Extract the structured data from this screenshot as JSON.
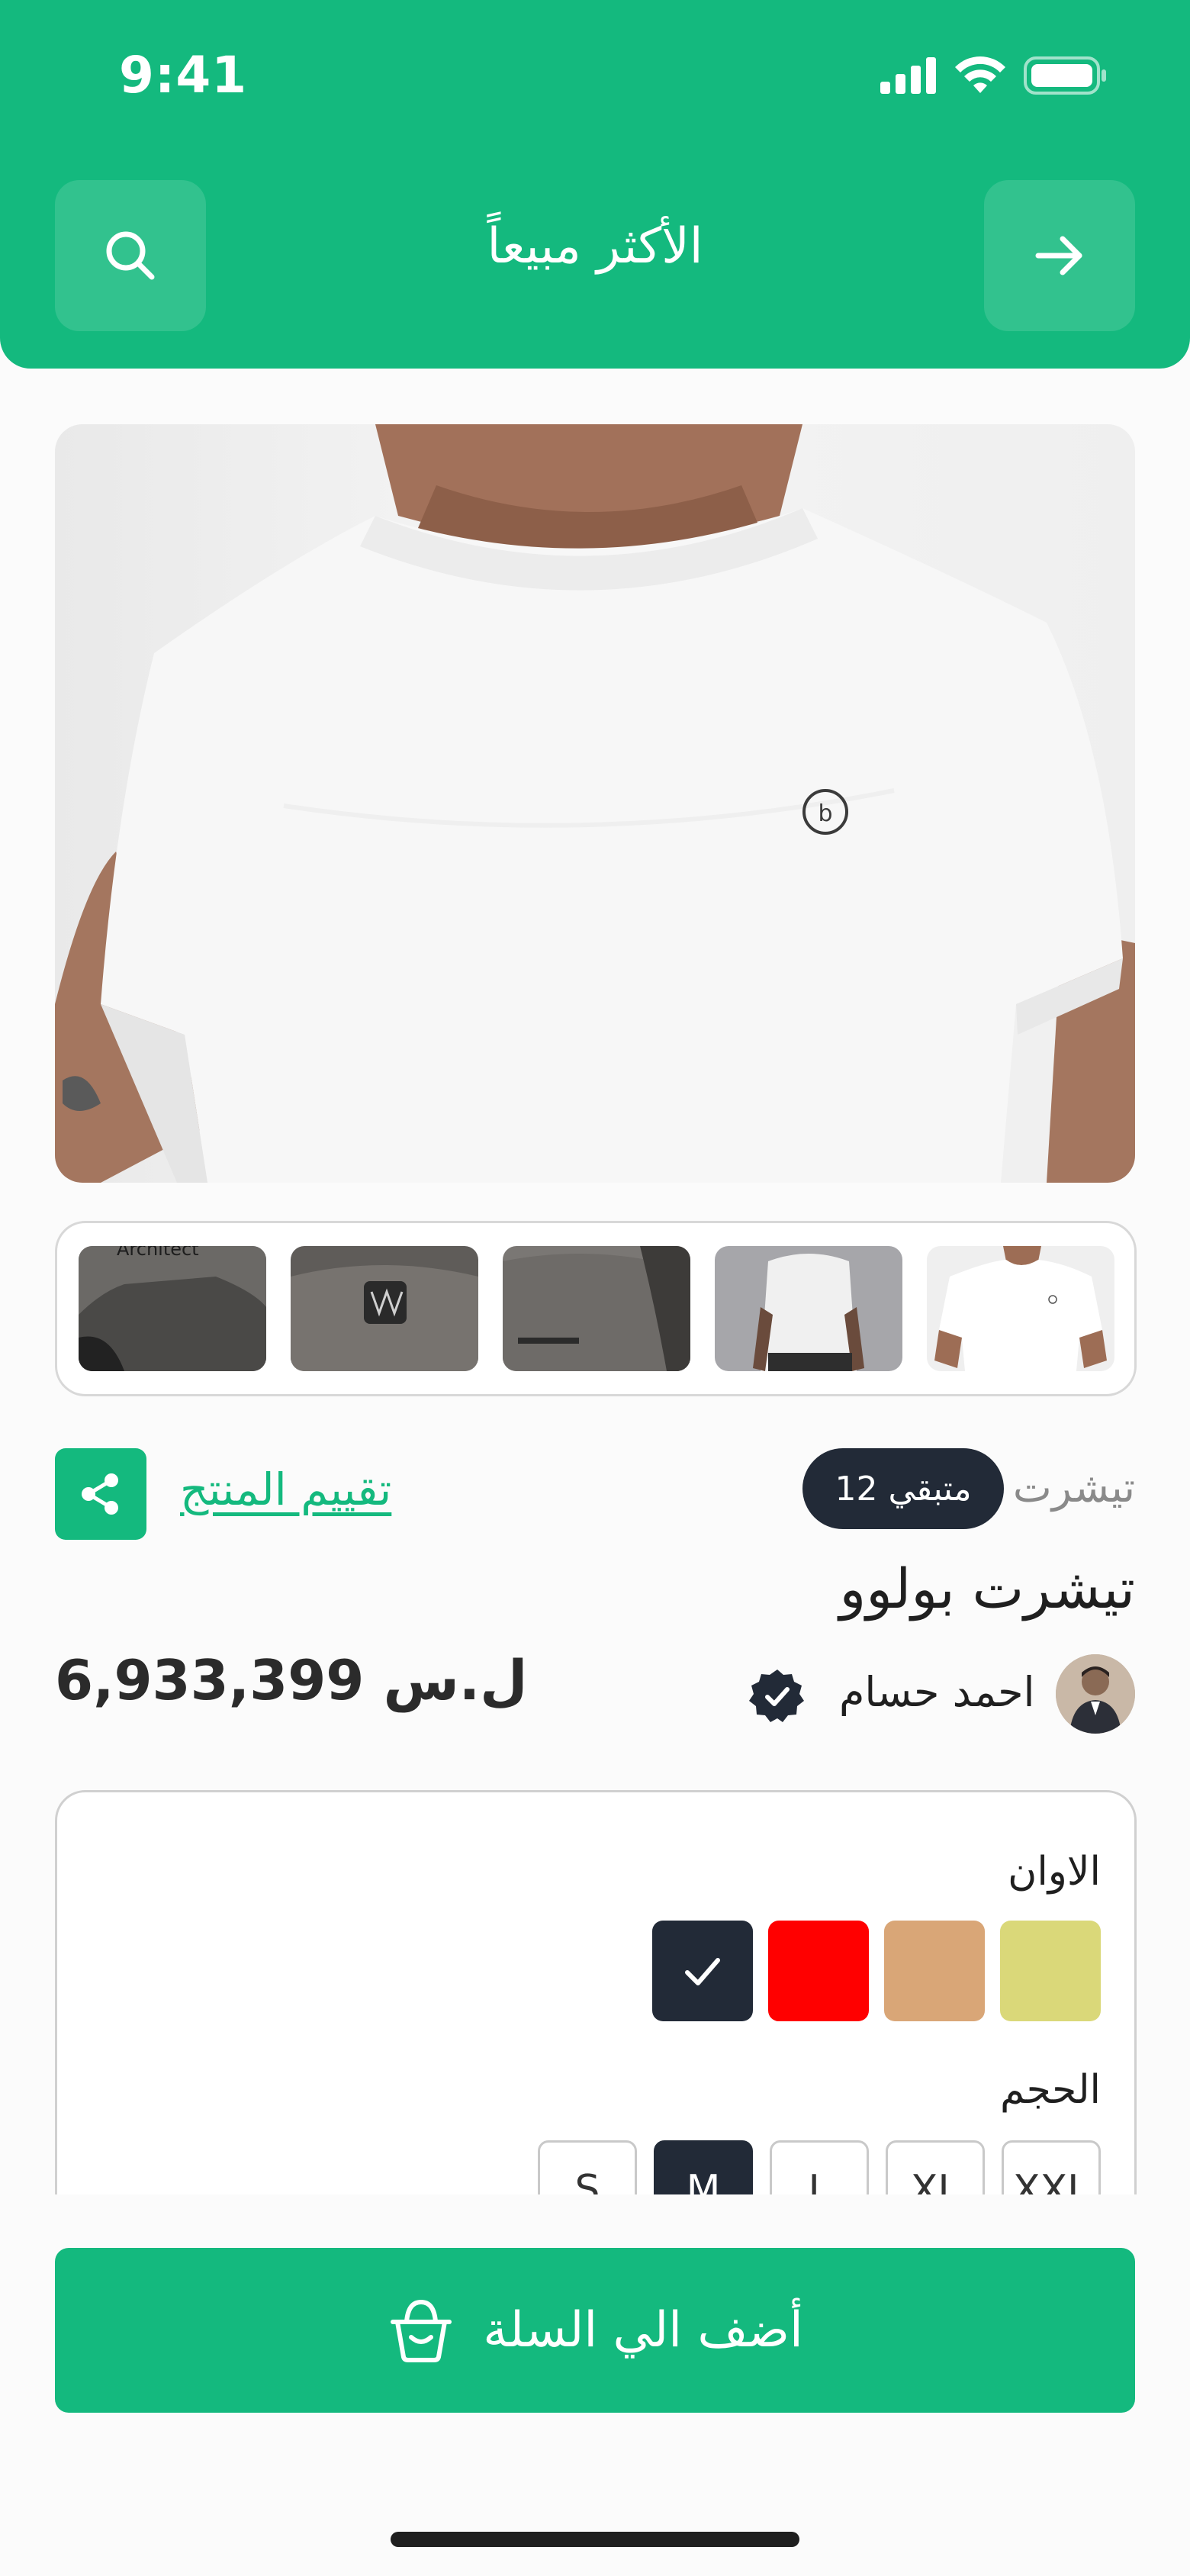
{
  "status_bar": {
    "time": "9:41"
  },
  "header": {
    "title": "الأكثر مبيعاً"
  },
  "product": {
    "category": "تيشرت",
    "stock_badge": "12 متبقي",
    "rate_link": "تقييم المنتج",
    "name": "تيشرت بولوو",
    "price": "6,933,399 ل.س",
    "seller_name": "احمد حسام"
  },
  "thumbnails": [
    {
      "print_text": "Architect"
    },
    {
      "print_text": ""
    },
    {
      "print_text": ""
    },
    {
      "print_text": ""
    },
    {
      "print_text": ""
    }
  ],
  "options": {
    "colors_label": "الاوان",
    "colors": [
      {
        "hex": "#dad879",
        "selected": false
      },
      {
        "hex": "#d9a677",
        "selected": false
      },
      {
        "hex": "#ff0000",
        "selected": false
      },
      {
        "hex": "#222a37",
        "selected": true
      }
    ],
    "size_label": "الحجم",
    "sizes": [
      {
        "label": "XXL",
        "selected": false
      },
      {
        "label": "XL",
        "selected": false
      },
      {
        "label": "L",
        "selected": false
      },
      {
        "label": "M",
        "selected": true
      },
      {
        "label": "S",
        "selected": false
      }
    ]
  },
  "cart_button": {
    "label": "أضف الي السلة"
  },
  "theme": {
    "accent": "#14b97e",
    "dark": "#222a37"
  }
}
